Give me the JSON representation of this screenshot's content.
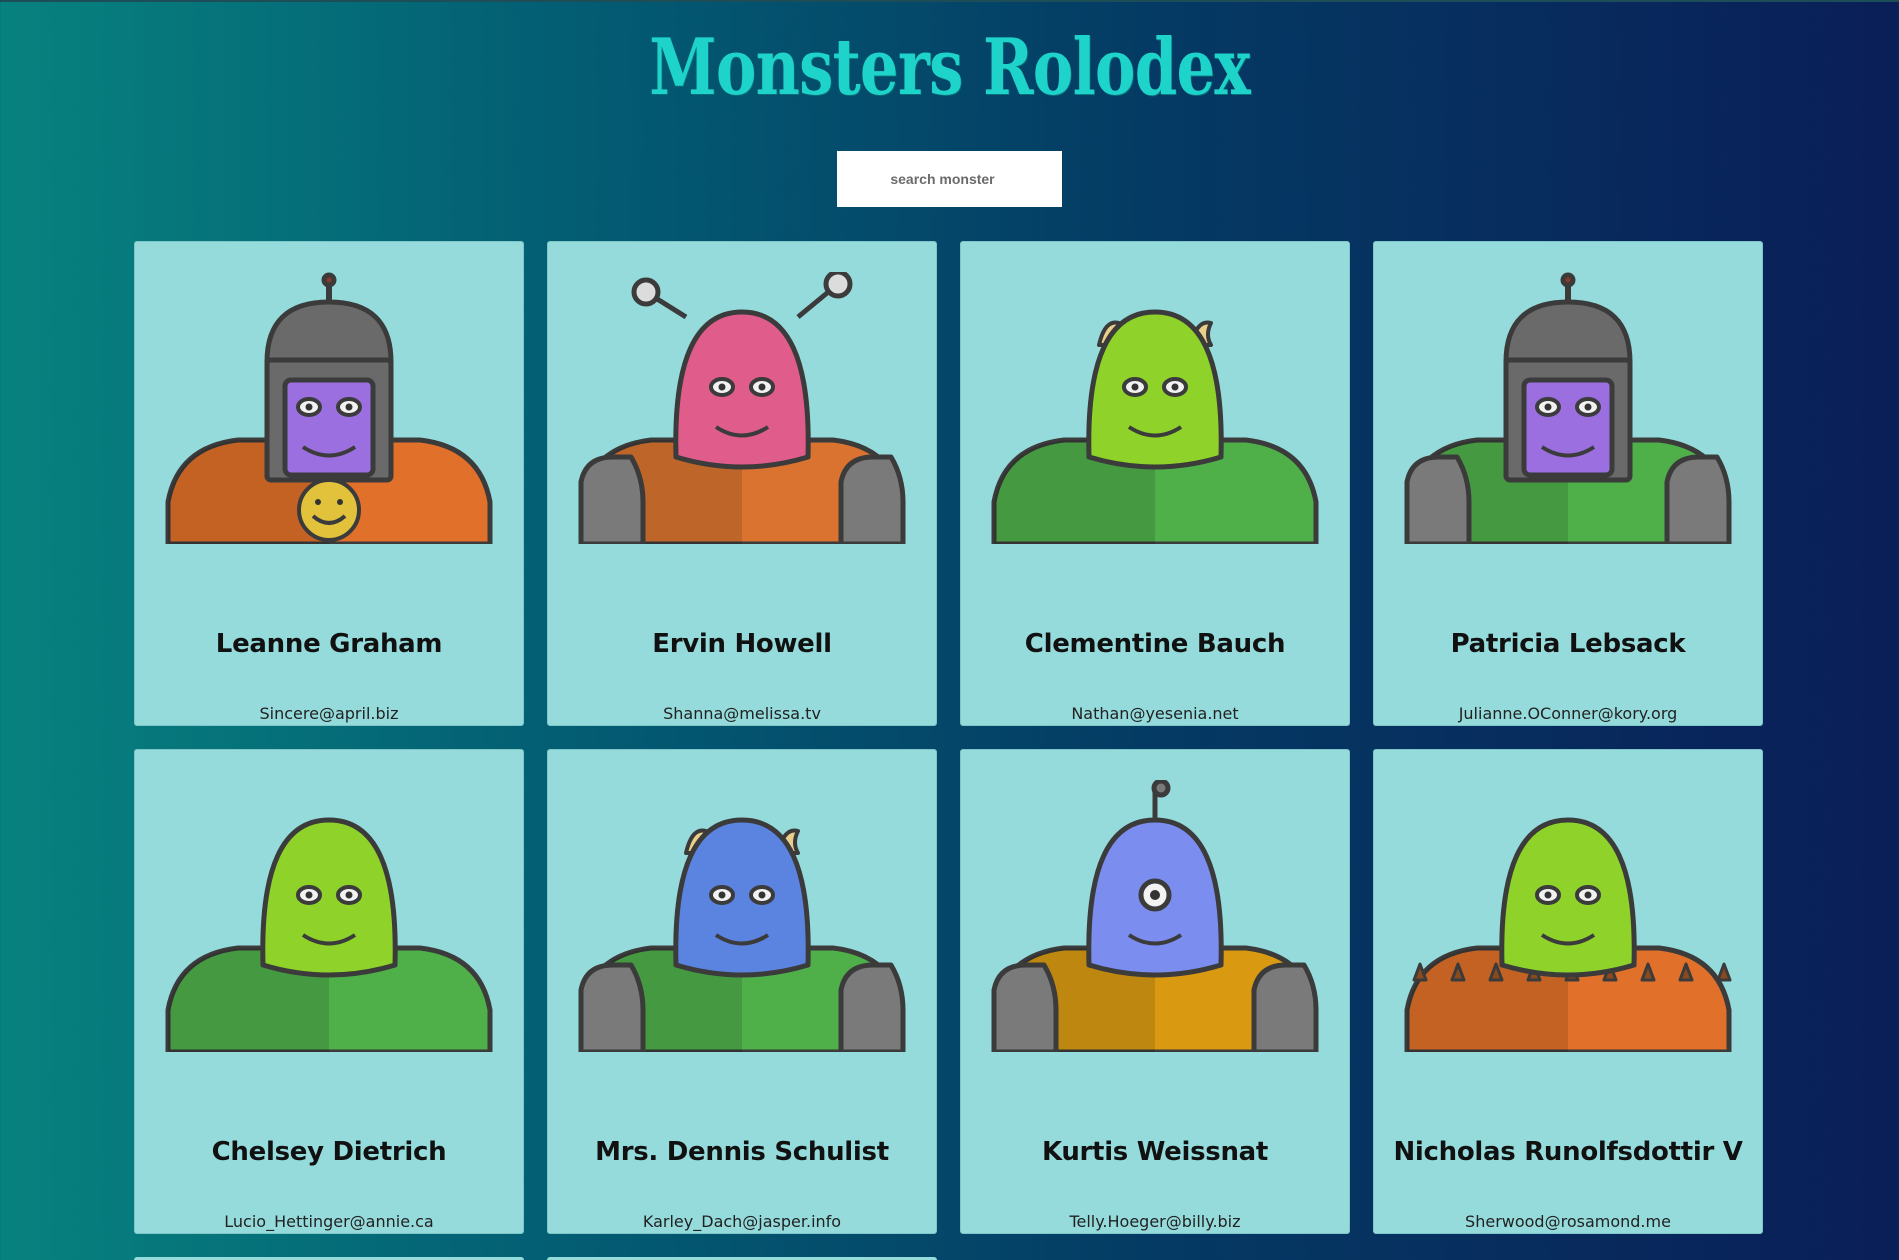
{
  "app": {
    "title": "Monsters Rolodex"
  },
  "search": {
    "placeholder": "search monster",
    "value": ""
  },
  "monsters": [
    {
      "name": "Leanne Graham",
      "email": "Sincere@april.biz",
      "head_color": "#9b6fe0",
      "body_color": "#e0702a",
      "helmet": "robot",
      "shoulders": "none",
      "emblem": "smiley-icon"
    },
    {
      "name": "Ervin Howell",
      "email": "Shanna@melissa.tv",
      "head_color": "#e05c8a",
      "body_color": "#d9732f",
      "helmet": "antenna-eyes",
      "shoulders": "armor",
      "emblem": "none"
    },
    {
      "name": "Clementine Bauch",
      "email": "Nathan@yesenia.net",
      "head_color": "#8fd22a",
      "body_color": "#4fb04a",
      "helmet": "horns",
      "shoulders": "none",
      "emblem": "none"
    },
    {
      "name": "Patricia Lebsack",
      "email": "Julianne.OConner@kory.org",
      "head_color": "#9b6fe0",
      "body_color": "#4fb04a",
      "helmet": "robot",
      "shoulders": "armor",
      "emblem": "none"
    },
    {
      "name": "Chelsey Dietrich",
      "email": "Lucio_Hettinger@annie.ca",
      "head_color": "#8fd22a",
      "body_color": "#4fb04a",
      "helmet": "plain",
      "shoulders": "none",
      "emblem": "none"
    },
    {
      "name": "Mrs. Dennis Schulist",
      "email": "Karley_Dach@jasper.info",
      "head_color": "#5b84e0",
      "body_color": "#4fb04a",
      "helmet": "horns",
      "shoulders": "armor",
      "emblem": "none"
    },
    {
      "name": "Kurtis Weissnat",
      "email": "Telly.Hoeger@billy.biz",
      "head_color": "#7b8ef0",
      "body_color": "#d99a12",
      "helmet": "cyclops",
      "shoulders": "armor",
      "emblem": "none"
    },
    {
      "name": "Nicholas Runolfsdottir V",
      "email": "Sherwood@rosamond.me",
      "head_color": "#8fd22a",
      "body_color": "#e0702a",
      "helmet": "plain",
      "shoulders": "spikes",
      "emblem": "none"
    }
  ]
}
